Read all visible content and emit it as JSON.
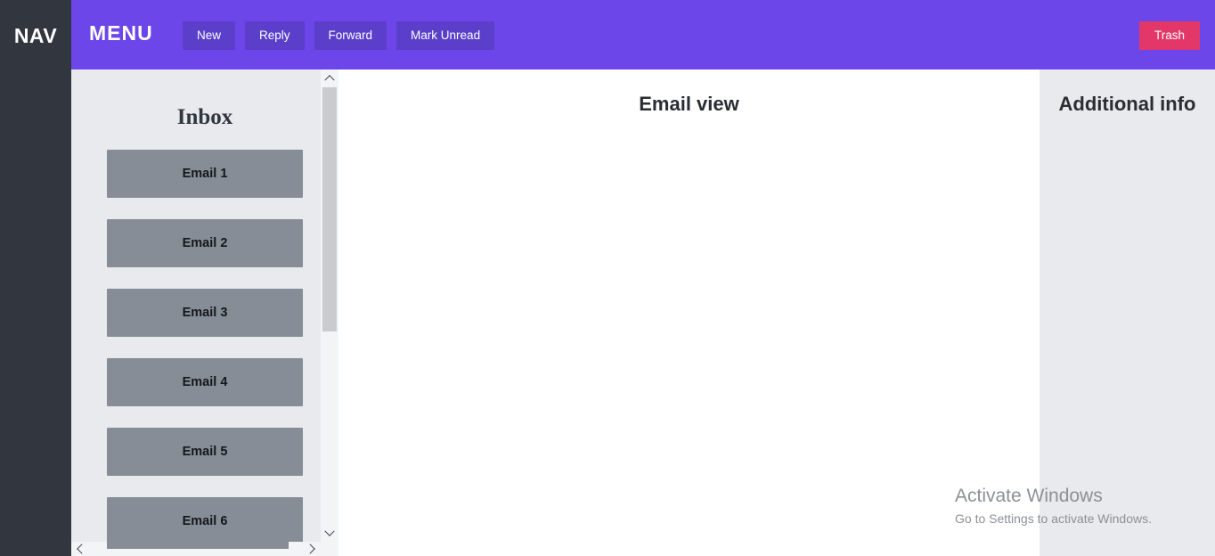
{
  "nav": {
    "label": "NAV"
  },
  "header": {
    "menu_label": "MENU",
    "bg_color": "#6c46e8",
    "button_color": "#5b3ec9",
    "actions": [
      {
        "label": "New"
      },
      {
        "label": "Reply"
      },
      {
        "label": "Forward"
      },
      {
        "label": "Mark Unread"
      }
    ],
    "trash": {
      "label": "Trash",
      "color": "#e3376a"
    }
  },
  "inbox": {
    "title": "Inbox",
    "bg_color": "#e8eaee",
    "item_color": "#868d96",
    "emails": [
      {
        "label": "Email 1"
      },
      {
        "label": "Email 2"
      },
      {
        "label": "Email 3"
      },
      {
        "label": "Email 4"
      },
      {
        "label": "Email 5"
      },
      {
        "label": "Email 6"
      }
    ],
    "scrollbar": {
      "up_arrow_icon": "chevron-up-icon",
      "down_arrow_icon": "chevron-down-icon",
      "left_arrow_icon": "chevron-left-icon",
      "right_arrow_icon": "chevron-right-icon"
    }
  },
  "email_view": {
    "title": "Email view"
  },
  "info_panel": {
    "title": "Additional info",
    "bg_color": "#e9eaee"
  },
  "watermark": {
    "title": "Activate Windows",
    "subtitle": "Go to Settings to activate Windows."
  }
}
